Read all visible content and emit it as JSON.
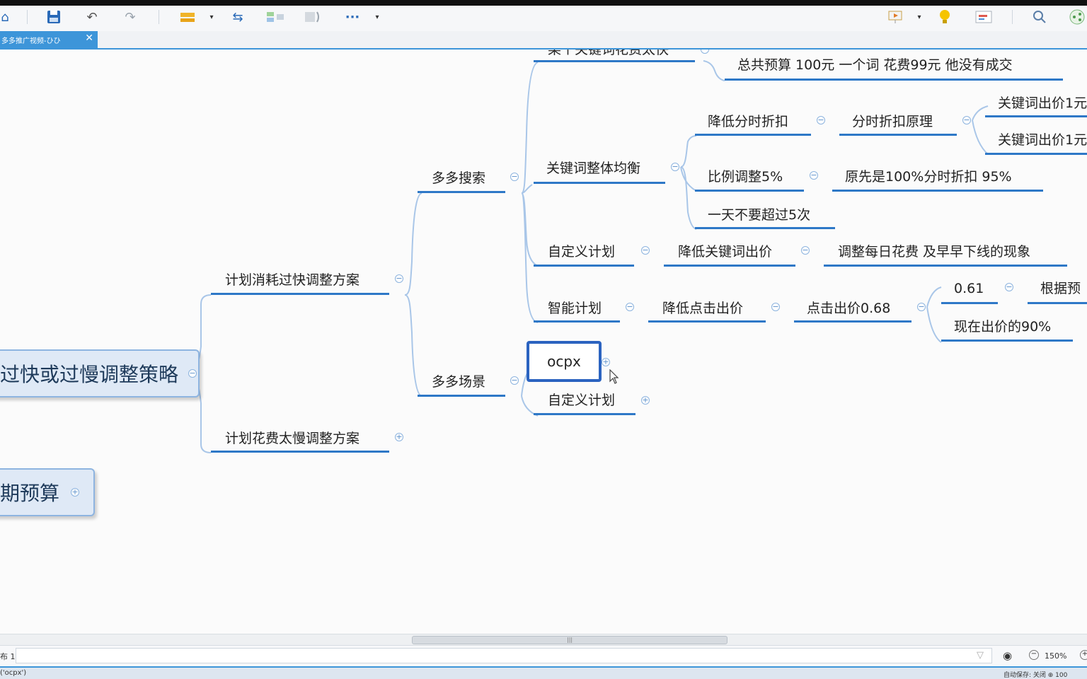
{
  "toolbar": {
    "more_label": "···",
    "dropdown_glyph": "▾"
  },
  "tab": {
    "title": "多多推广视频-ひひ",
    "close": "✕"
  },
  "mindmap": {
    "central": "过快或过慢调整策略",
    "central2": "期预算",
    "branch_fast": "计划消耗过快调整方案",
    "branch_slow": "计划花费太慢调整方案",
    "duoduo_search": "多多搜索",
    "duoduo_scene": "多多场景",
    "keyword_top": "某个关键词花费太快",
    "keyword_top_detail": "总共预算 100元  一个词 花费99元 他没有成交",
    "keyword_balance": "关键词整体均衡",
    "lower_time_discount": "降低分时折扣",
    "time_discount_principle": "分时折扣原理",
    "kw_bid_1": "关键词出价1元",
    "kw_bid_2": "关键词出价1元",
    "ratio_adjust": "比例调整5%",
    "original_discount": "原先是100%分时折扣 95%",
    "max_per_day": "一天不要超过5次",
    "custom_plan": "自定义计划",
    "lower_kw_bid": "降低关键词出价",
    "adjust_daily": "调整每日花费 及早早下线的现象",
    "smart_plan": "智能计划",
    "lower_click_bid": "降低点击出价",
    "click_bid": "点击出价0.68",
    "value_061": "0.61",
    "by_budget": "根据预",
    "current_bid_90": "现在出价的90%",
    "ocpx": "ocpx",
    "scene_custom_plan": "自定义计划"
  },
  "toggles": {
    "collapse": "−",
    "expand": "+"
  },
  "status": {
    "sheet": "布 1",
    "zoom": "150%",
    "bottom_left": "('ocpx')",
    "bottom_right": "自动保存: 关闭  ⊕ 100"
  },
  "colors": {
    "accent": "#2e78c7",
    "tab": "#3d95d9",
    "connector": "#a9c6e8",
    "node_fill": "#dfe9f6"
  }
}
